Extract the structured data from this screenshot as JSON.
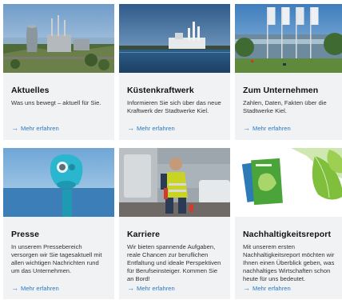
{
  "cards": [
    {
      "title": "Aktuelles",
      "text": "Was uns bewegt – aktuell für Sie.",
      "link": "Mehr erfahren",
      "image_icon": "power-plant-aerial-photo"
    },
    {
      "title": "Küstenkraftwerk",
      "text": "Informieren Sie sich über das neue Kraftwerk der Stadtwerke Kiel.",
      "link": "Mehr erfahren",
      "image_icon": "coastal-power-plant-photo"
    },
    {
      "title": "Zum Unternehmen",
      "text": "Zahlen, Daten, Fakten über die Stadtwerke Kiel.",
      "link": "Mehr erfahren",
      "image_icon": "headquarters-flags-photo"
    },
    {
      "title": "Presse",
      "text": "In unserem Pressebereich versorgen wir Sie tagesaktuell mit allen wichtigen Nachrichten rund um das Unternehmen.",
      "link": "Mehr erfahren",
      "image_icon": "binocular-viewer-photo"
    },
    {
      "title": "Karriere",
      "text": "Wir bieten spannende Aufgaben, reale Chancen zur beruflichen Entfaltung und ideale Perspektiven für Berufseinsteiger. Kommen Sie an Bord!",
      "link": "Mehr erfahren",
      "image_icon": "worker-safety-vest-photo"
    },
    {
      "title": "Nachhaltigkeitsreport",
      "text": "Mit unserem ersten Nachhaltigkeitsreport möchten wir Ihnen einen Überblick geben, was nachhaltiges Wirtschaften schon heute für uns bedeutet.",
      "link": "Mehr erfahren",
      "image_icon": "sustainability-report-leaf-photo"
    }
  ],
  "colors": {
    "card_bg": "#f1f2f3",
    "link": "#2a7ac7",
    "title": "#111111"
  },
  "link_arrow": "→"
}
